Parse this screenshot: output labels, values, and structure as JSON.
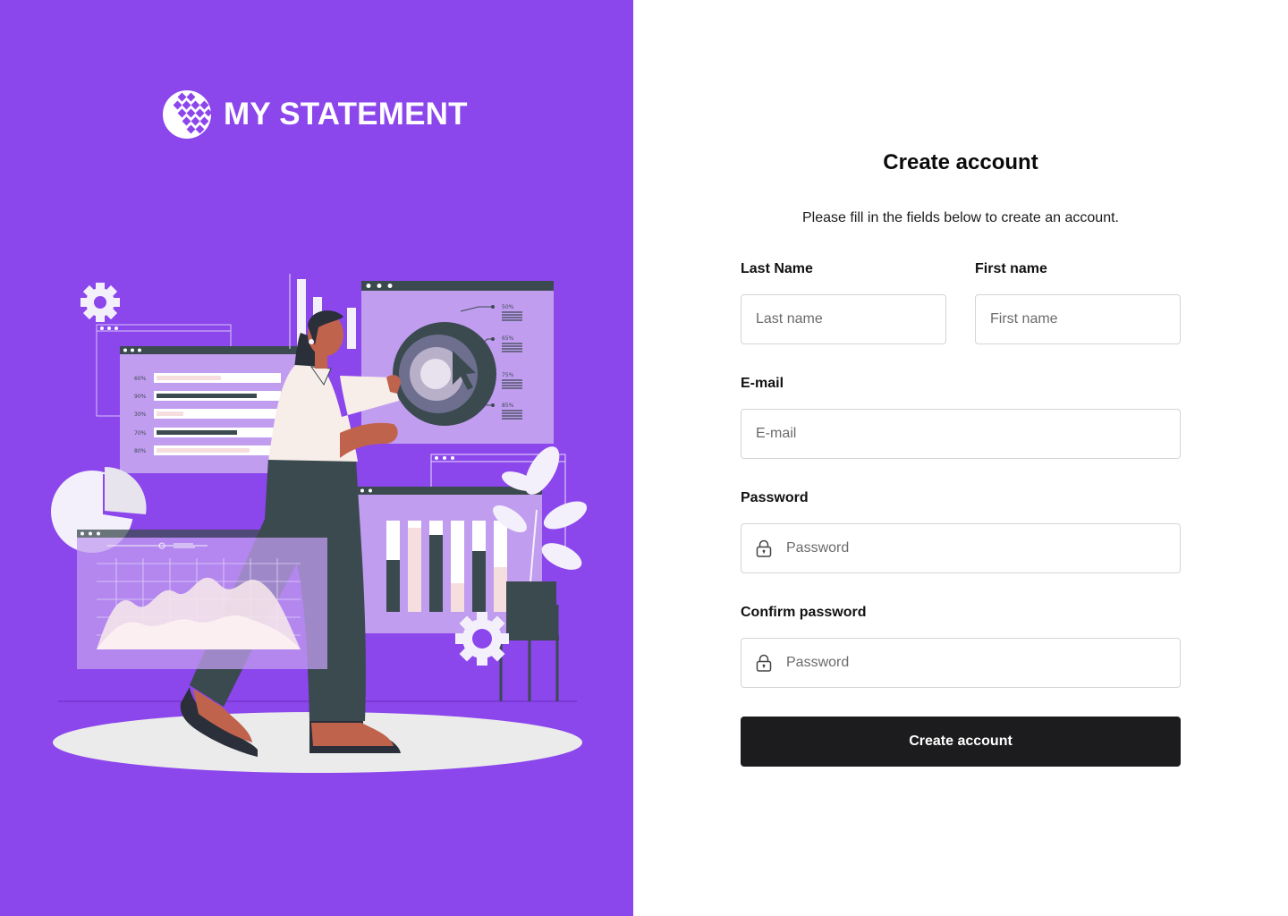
{
  "brand": {
    "name": "MY STATEMENT",
    "logo_icon": "grid-globe-icon"
  },
  "colors": {
    "brand_purple": "#8b46ec",
    "button_dark": "#1c1c1e",
    "field_border": "#d4d4d8"
  },
  "illustration": {
    "icon": "woman-analyzing-charts-illustration",
    "bar_labels": [
      "60%",
      "90%",
      "30%",
      "70%",
      "80%"
    ],
    "donut_labels": [
      "50%",
      "65%",
      "75%",
      "85%"
    ]
  },
  "form": {
    "title": "Create account",
    "subtitle": "Please fill in the fields below to create an account.",
    "last_name": {
      "label": "Last Name",
      "placeholder": "Last name",
      "value": ""
    },
    "first_name": {
      "label": "First name",
      "placeholder": "First name",
      "value": ""
    },
    "email": {
      "label": "E-mail",
      "placeholder": "E-mail",
      "value": ""
    },
    "password": {
      "label": "Password",
      "placeholder": "Password",
      "value": "",
      "icon": "lock-icon"
    },
    "confirm_password": {
      "label": "Confirm password",
      "placeholder": "Password",
      "value": "",
      "icon": "lock-icon"
    },
    "submit_label": "Create account"
  }
}
